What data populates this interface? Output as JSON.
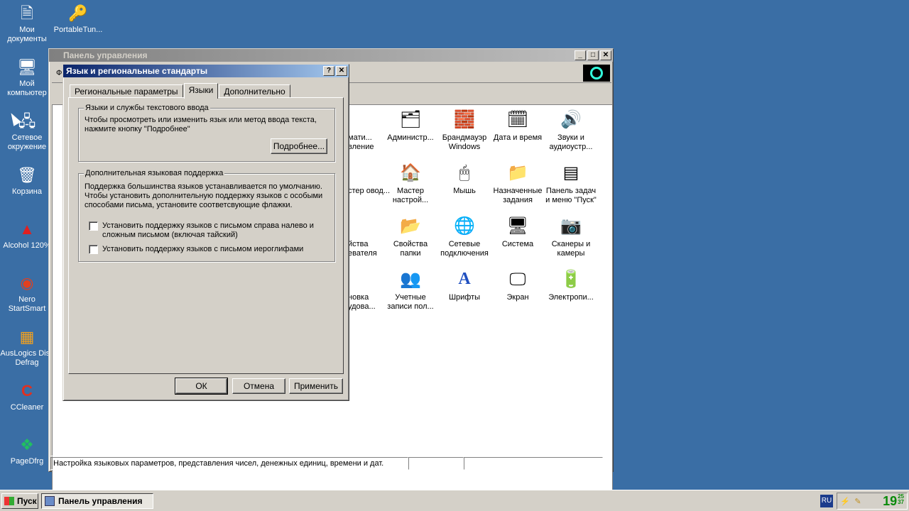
{
  "desktop": {
    "icons": [
      {
        "label": "Мои документы",
        "icon": "folder-documents-icon",
        "glyph": "🗎"
      },
      {
        "label": "PortableTun...",
        "icon": "portable-tuneup-icon",
        "glyph": "🔑"
      },
      {
        "label": "Мой компьютер",
        "icon": "computer-icon",
        "glyph": "🖥"
      },
      {
        "label": "Сетевое окружение",
        "icon": "network-icon",
        "glyph": "🖧"
      },
      {
        "label": "Корзина",
        "icon": "recycle-bin-icon",
        "glyph": "🗑"
      },
      {
        "label": "Alcohol 120%",
        "icon": "alcohol-icon",
        "glyph": "▲"
      },
      {
        "label": "Nero StartSmart",
        "icon": "nero-icon",
        "glyph": "◉"
      },
      {
        "label": "AusLogics Disk Defrag",
        "icon": "defrag-icon",
        "glyph": "▦"
      },
      {
        "label": "CCleaner",
        "icon": "ccleaner-icon",
        "glyph": "C"
      },
      {
        "label": "PageDfrg",
        "icon": "pagedfrg-icon",
        "glyph": "❖"
      }
    ]
  },
  "control_panel": {
    "title": "Панель управления",
    "toolbar_partial": "Ф",
    "status_text": "Настройка языковых параметров, представления чисел, денежных единиц, времени и дат.",
    "partial_items": [
      {
        "label": "мати... вление"
      },
      {
        "label": "стер овод..."
      },
      {
        "label": "йства евателя"
      },
      {
        "label": "новка удова..."
      }
    ],
    "items": [
      {
        "label": "Администр...",
        "glyph": "🗂"
      },
      {
        "label": "Брандмауэр Windows",
        "glyph": "🧱"
      },
      {
        "label": "Дата и время",
        "glyph": "🗓"
      },
      {
        "label": "Звуки и аудиоустр...",
        "glyph": "🔊"
      },
      {
        "label": "Мастер настрой...",
        "glyph": "🏠"
      },
      {
        "label": "Мышь",
        "glyph": "🖱"
      },
      {
        "label": "Назначенные задания",
        "glyph": "📁"
      },
      {
        "label": "Панель задач и меню \"Пуск\"",
        "glyph": "▤"
      },
      {
        "label": "Свойства папки",
        "glyph": "📂"
      },
      {
        "label": "Сетевые подключения",
        "glyph": "🌐"
      },
      {
        "label": "Система",
        "glyph": "🖥"
      },
      {
        "label": "Сканеры и камеры",
        "glyph": "📷"
      },
      {
        "label": "Учетные записи пол...",
        "glyph": "👥"
      },
      {
        "label": "Шрифты",
        "glyph": "A"
      },
      {
        "label": "Экран",
        "glyph": "🖵"
      },
      {
        "label": "Электропи...",
        "glyph": "🔋"
      }
    ]
  },
  "dialog": {
    "title": "Язык и региональные стандарты",
    "help_btn": "?",
    "close_btn": "✕",
    "tabs": [
      "Региональные параметры",
      "Языки",
      "Дополнительно"
    ],
    "group1": {
      "title": "Языки и службы текстового ввода",
      "text": "Чтобы просмотреть или изменить язык или метод ввода текста, нажмите кнопку \"Подробнее\"",
      "button": "Подробнее..."
    },
    "group2": {
      "title": "Дополнительная языковая поддержка",
      "text": "Поддержка большинства языков устанавливается по умолчанию. Чтобы установить дополнительную поддержку языков с особыми способами письма, установите соответсвующие флажки.",
      "checkbox1": "Установить поддержку языков с письмом справа налево и сложным письмом (включая тайский)",
      "checkbox2": "Установить поддержку языков с письмом иероглифами"
    },
    "ok": "ОК",
    "cancel": "Отмена",
    "apply": "Применить"
  },
  "taskbar": {
    "start": "Пуск",
    "task": "Панель управления",
    "lang": "RU",
    "clock_hm": "19",
    "clock_sec_top": "25",
    "clock_sec_bottom": "37"
  }
}
